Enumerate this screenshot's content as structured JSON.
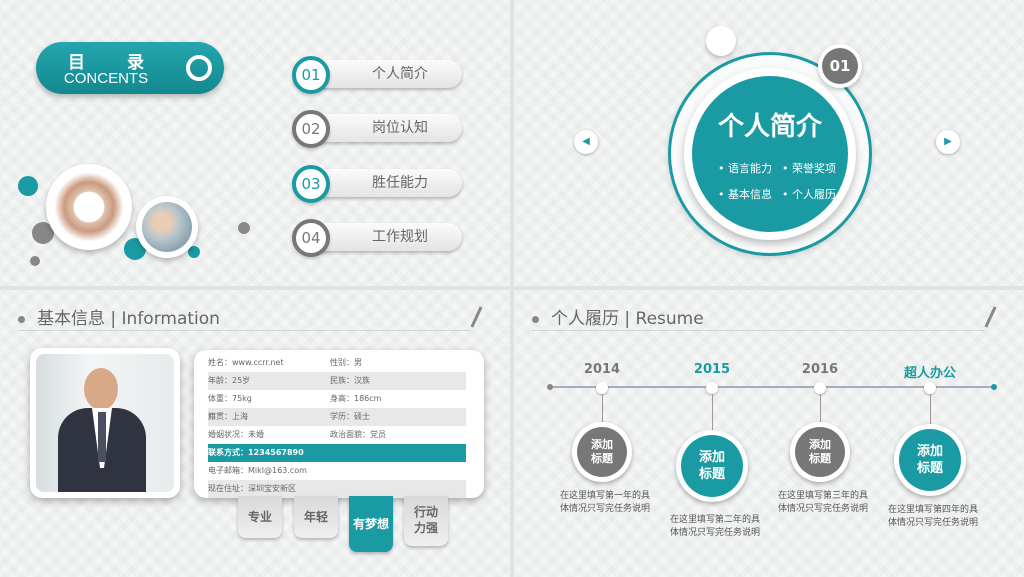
{
  "toc": {
    "title": "目 录",
    "subtitle": "CONCENTS"
  },
  "menu": [
    {
      "num": "01",
      "label": "个人简介"
    },
    {
      "num": "02",
      "label": "岗位认知"
    },
    {
      "num": "03",
      "label": "胜任能力"
    },
    {
      "num": "04",
      "label": "工作规划"
    }
  ],
  "intro": {
    "num": "01",
    "title": "个人简介",
    "bullets": [
      "• 语言能力",
      "• 荣誉奖项",
      "• 基本信息",
      "• 个人履历"
    ]
  },
  "info": {
    "header": "基本信息 | Information",
    "rows": [
      {
        "a": "姓名：www.ccrr.net",
        "b": "性别：男"
      },
      {
        "a": "年龄：25岁",
        "b": "民族：汉族"
      },
      {
        "a": "体重：75kg",
        "b": "身高：186cm"
      },
      {
        "a": "籍贯：上海",
        "b": "学历：硕士"
      },
      {
        "a": "婚姻状况：未婚",
        "b": "政治面貌：党员"
      },
      {
        "a": "联系方式：1234567890",
        "b": ""
      },
      {
        "a": "电子邮箱：Mikl@163.com",
        "b": ""
      },
      {
        "a": "现在住址：深圳宝安新区",
        "b": ""
      }
    ],
    "tags": [
      "专业",
      "年轻",
      "有梦想",
      "行动力强"
    ]
  },
  "resume": {
    "header": "个人履历 | Resume",
    "items": [
      {
        "year": "2014",
        "node": "添加\n标题",
        "desc": "在这里填写第一年的具体情况只写完任务说明"
      },
      {
        "year": "2015",
        "node": "添加\n标题",
        "desc": "在这里填写第二年的具体情况只写完任务说明"
      },
      {
        "year": "2016",
        "node": "添加\n标题",
        "desc": "在这里填写第三年的具体情况只写完任务说明"
      },
      {
        "year": "超人办公",
        "node": "添加\n标题",
        "desc": "在这里填写第四年的具体情况只写完任务说明"
      }
    ]
  },
  "colors": {
    "accent": "#1a9ba3",
    "gray": "#777777"
  }
}
